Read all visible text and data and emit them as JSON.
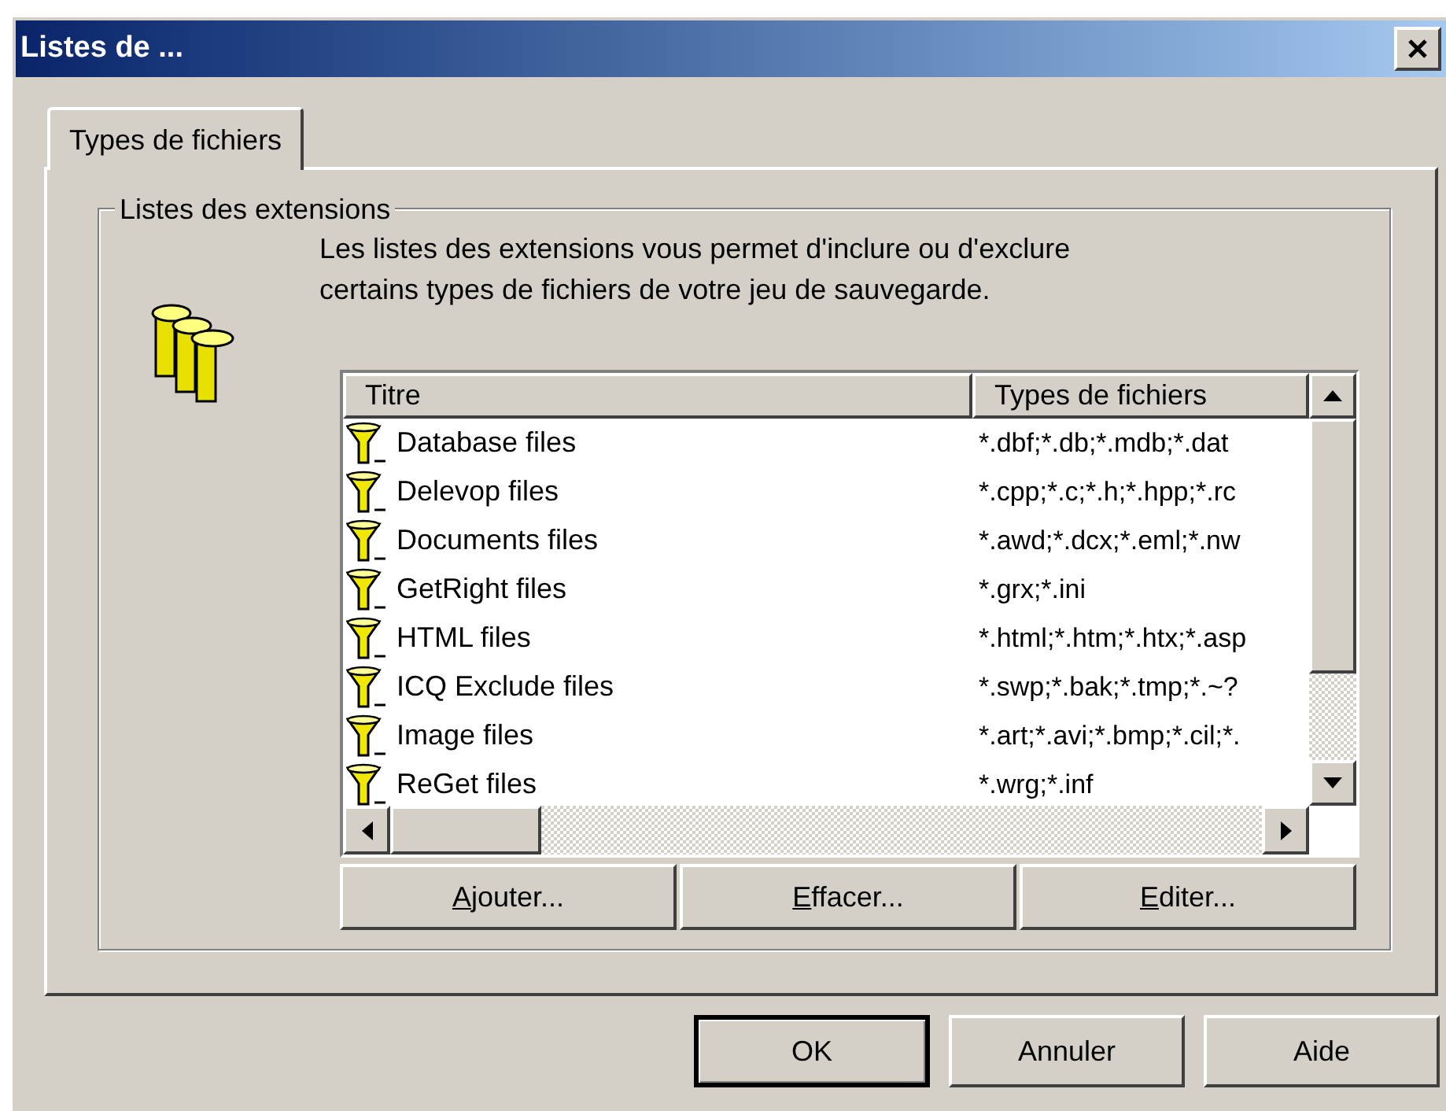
{
  "window": {
    "title": "Listes de ..."
  },
  "tabs": [
    {
      "label": "Types de fichiers",
      "selected": true
    }
  ],
  "group": {
    "title": "Listes des extensions",
    "description": "Les listes des extensions vous permet d'inclure ou d'exclure certains types de fichiers de votre jeu de sauvegarde."
  },
  "table": {
    "columns": [
      "Titre",
      "Types de fichiers"
    ],
    "rows": [
      {
        "title": "Database files",
        "types": "*.dbf;*.db;*.mdb;*.dat"
      },
      {
        "title": "Delevop files",
        "types": "*.cpp;*.c;*.h;*.hpp;*.rc"
      },
      {
        "title": "Documents files",
        "types": "*.awd;*.dcx;*.eml;*.nw"
      },
      {
        "title": "GetRight files",
        "types": "*.grx;*.ini"
      },
      {
        "title": "HTML files",
        "types": "*.html;*.htm;*.htx;*.asp"
      },
      {
        "title": "ICQ Exclude files",
        "types": "*.swp;*.bak;*.tmp;*.~?"
      },
      {
        "title": "Image files",
        "types": "*.art;*.avi;*.bmp;*.cil;*."
      },
      {
        "title": "ReGet files",
        "types": "*.wrg;*.inf"
      }
    ]
  },
  "list_buttons": [
    {
      "label": "Ajouter...",
      "underline_first": true
    },
    {
      "label": "Effacer...",
      "underline_first": true
    },
    {
      "label": "Editer...",
      "underline_first": true
    }
  ],
  "dialog_buttons": [
    {
      "label": "OK",
      "default": true
    },
    {
      "label": "Annuler",
      "default": false
    },
    {
      "label": "Aide",
      "default": false
    }
  ]
}
